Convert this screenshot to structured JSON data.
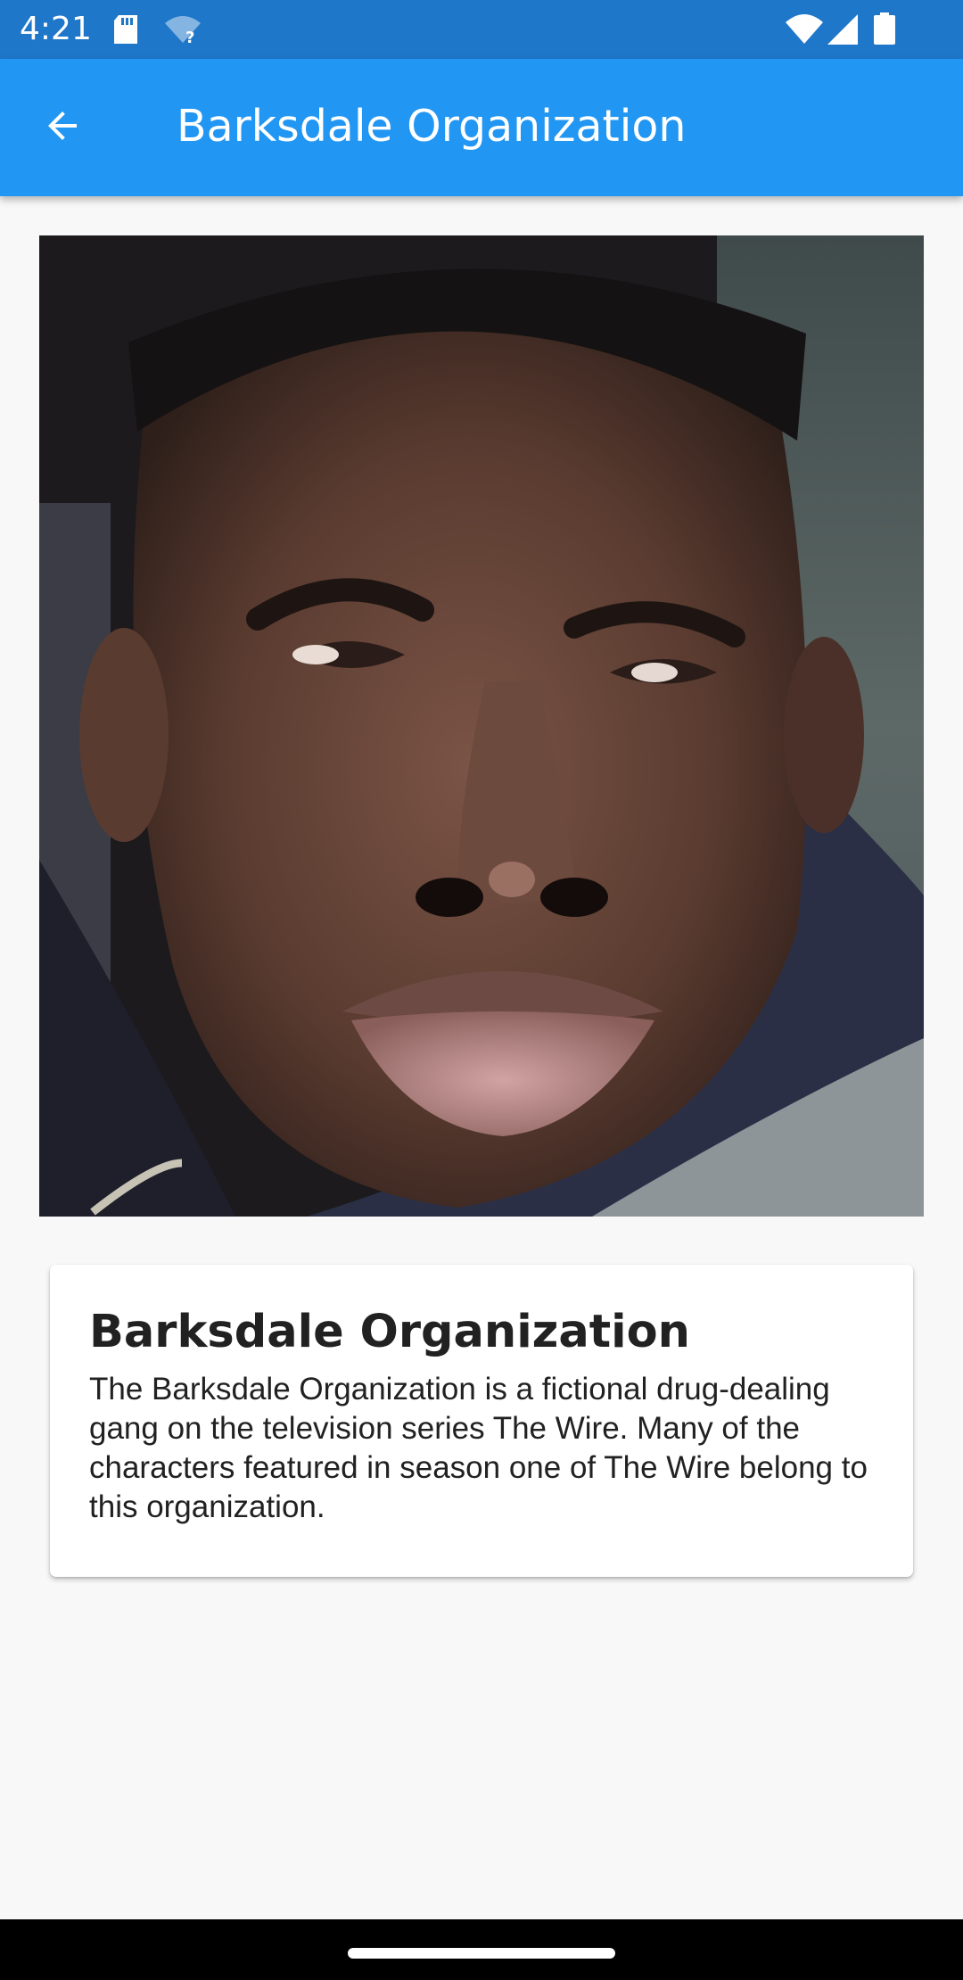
{
  "status_bar": {
    "time": "4:21",
    "icons": [
      "sd-card-icon",
      "wifi-question-icon",
      "wifi-icon",
      "cell-signal-icon",
      "battery-icon"
    ]
  },
  "app_bar": {
    "title": "Barksdale Organization",
    "back_icon": "arrow-back-icon",
    "color": "#2196f3"
  },
  "card": {
    "title": "Barksdale Organization",
    "description": "The Barksdale Organization is a fictional drug-dealing gang on the television series The Wire. Many of the characters featured in season one of The Wire belong to this organization."
  },
  "colors": {
    "status_bar": "#1f77c9",
    "app_bar": "#2196f3",
    "background": "#f8f8f8",
    "nav_bar": "#000000"
  }
}
